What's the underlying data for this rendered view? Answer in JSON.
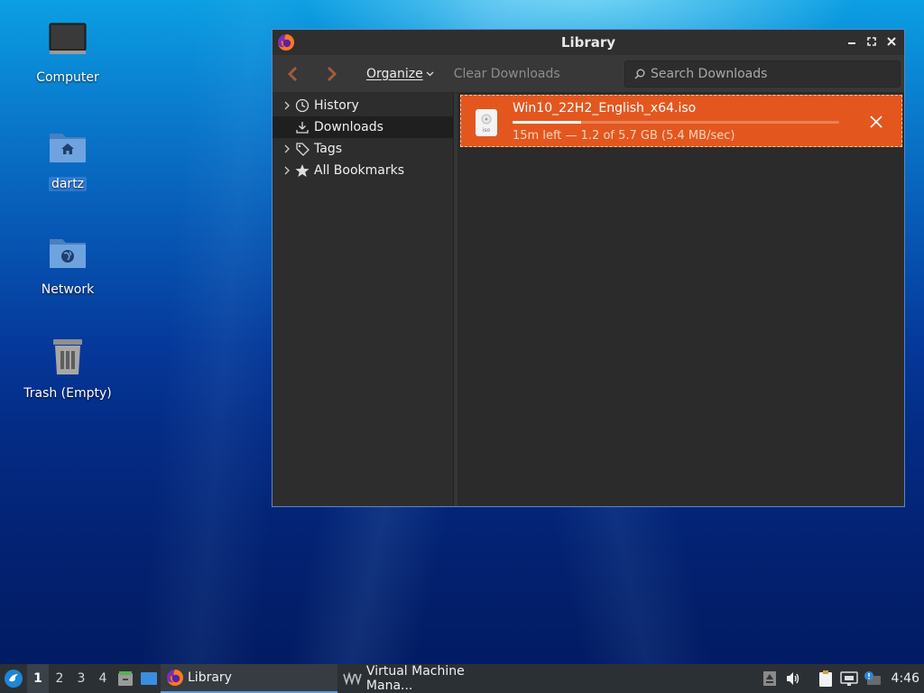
{
  "desktop": {
    "icons": [
      {
        "label": "Computer",
        "icon": "monitor-icon"
      },
      {
        "label": "dartz",
        "icon": "home-folder-icon"
      },
      {
        "label": "Network",
        "icon": "network-folder-icon"
      },
      {
        "label": "Trash (Empty)",
        "icon": "trash-icon"
      }
    ]
  },
  "window": {
    "title": "Library",
    "app_icon": "firefox-icon",
    "controls": [
      "minimize-icon",
      "maximize-icon",
      "close-icon"
    ],
    "border_color": "#5b87c5"
  },
  "toolbar": {
    "organize_label": "Organize",
    "clear_downloads_label": "Clear Downloads",
    "search_placeholder": "Search Downloads"
  },
  "sidebar": {
    "items": [
      {
        "label": "History",
        "icon": "clock-icon",
        "expandable": true
      },
      {
        "label": "Downloads",
        "icon": "download-icon",
        "expandable": false,
        "selected": true
      },
      {
        "label": "Tags",
        "icon": "tag-icon",
        "expandable": true
      },
      {
        "label": "All Bookmarks",
        "icon": "star-icon",
        "expandable": true
      }
    ]
  },
  "downloads": [
    {
      "file_name": "Win10_22H2_English_x64.iso",
      "file_type": "iso",
      "status": "15m left — 1.2 of 5.7 GB (5.4 MB/sec)",
      "progress": 0.21,
      "highlight_color": "#e3571f"
    }
  ],
  "taskbar": {
    "workspaces": [
      "1",
      "2",
      "3",
      "4"
    ],
    "active_workspace": "1",
    "tasks": [
      {
        "label": "Library",
        "icon": "firefox-icon",
        "active": true
      },
      {
        "label": "Virtual Machine Mana...",
        "icon": "virt-manager-icon",
        "active": false
      }
    ],
    "clock": "4:46"
  }
}
